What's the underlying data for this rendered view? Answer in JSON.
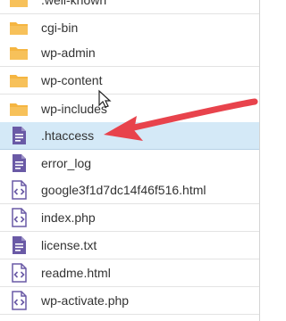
{
  "file_list": {
    "items": [
      {
        "name": ".well-known",
        "type": "folder",
        "selected": false
      },
      {
        "name": "cgi-bin",
        "type": "folder",
        "selected": false
      },
      {
        "name": "wp-admin",
        "type": "folder",
        "selected": false
      },
      {
        "name": "wp-content",
        "type": "folder",
        "selected": false
      },
      {
        "name": "wp-includes",
        "type": "folder",
        "selected": false
      },
      {
        "name": ".htaccess",
        "type": "text",
        "selected": true
      },
      {
        "name": "error_log",
        "type": "text",
        "selected": false
      },
      {
        "name": "google3f1d7dc14f46f516.html",
        "type": "code",
        "selected": false
      },
      {
        "name": "index.php",
        "type": "code",
        "selected": false
      },
      {
        "name": "license.txt",
        "type": "text",
        "selected": false
      },
      {
        "name": "readme.html",
        "type": "code",
        "selected": false
      },
      {
        "name": "wp-activate.php",
        "type": "code",
        "selected": false
      }
    ]
  },
  "icons": {
    "folder": "folder-icon",
    "text": "text-file-icon",
    "code": "code-file-icon"
  },
  "colors": {
    "folder": "#f5b541",
    "file_icon": "#6a5aa6",
    "selected_row": "#d4e9f7",
    "annotation_arrow": "#e8434c"
  }
}
